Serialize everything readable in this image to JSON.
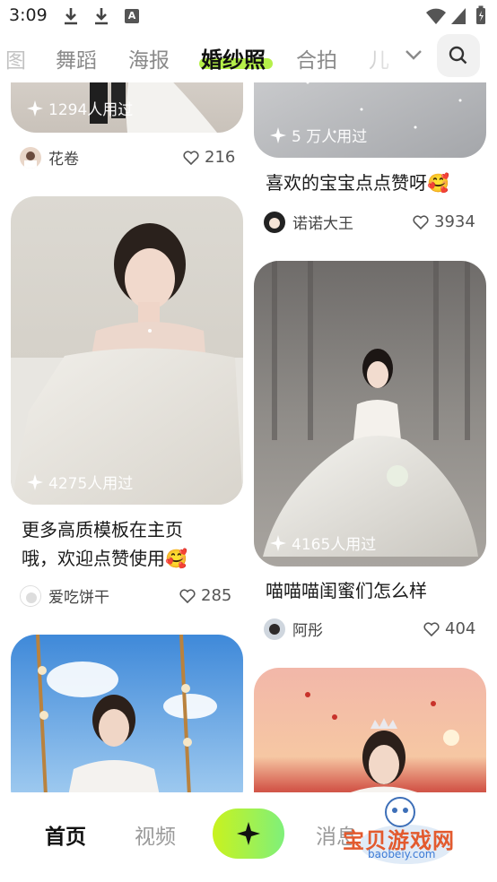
{
  "status": {
    "time": "3:09",
    "sys_label": "A"
  },
  "tabs": [
    {
      "label": "图"
    },
    {
      "label": "舞蹈"
    },
    {
      "label": "海报"
    },
    {
      "label": "婚纱照"
    },
    {
      "label": "合拍"
    },
    {
      "label": "儿"
    }
  ],
  "active_tab": "婚纱照",
  "accent_color": "#b6f04a",
  "feed": {
    "left": [
      {
        "used": "1294人用过",
        "author": "花卷",
        "likes": "216"
      },
      {
        "used": "4275人用过",
        "title_line1": "更多高质模板在主页",
        "title_line2": "哦，欢迎点赞使用🥰",
        "author": "爱吃饼干",
        "likes": "285"
      }
    ],
    "right": [
      {
        "used": "5 万人用过",
        "title": "喜欢的宝宝点点赞呀🥰",
        "author": "诺诺大王",
        "likes": "3934"
      },
      {
        "used": "4165人用过",
        "title": "喵喵喵闺蜜们怎么样",
        "author": "阿彤",
        "likes": "404"
      }
    ]
  },
  "bottom_nav": {
    "home": "首页",
    "video": "视频",
    "messages": "消息",
    "watermark": "宝贝游戏网",
    "watermark_url": "baobeiy.com"
  }
}
